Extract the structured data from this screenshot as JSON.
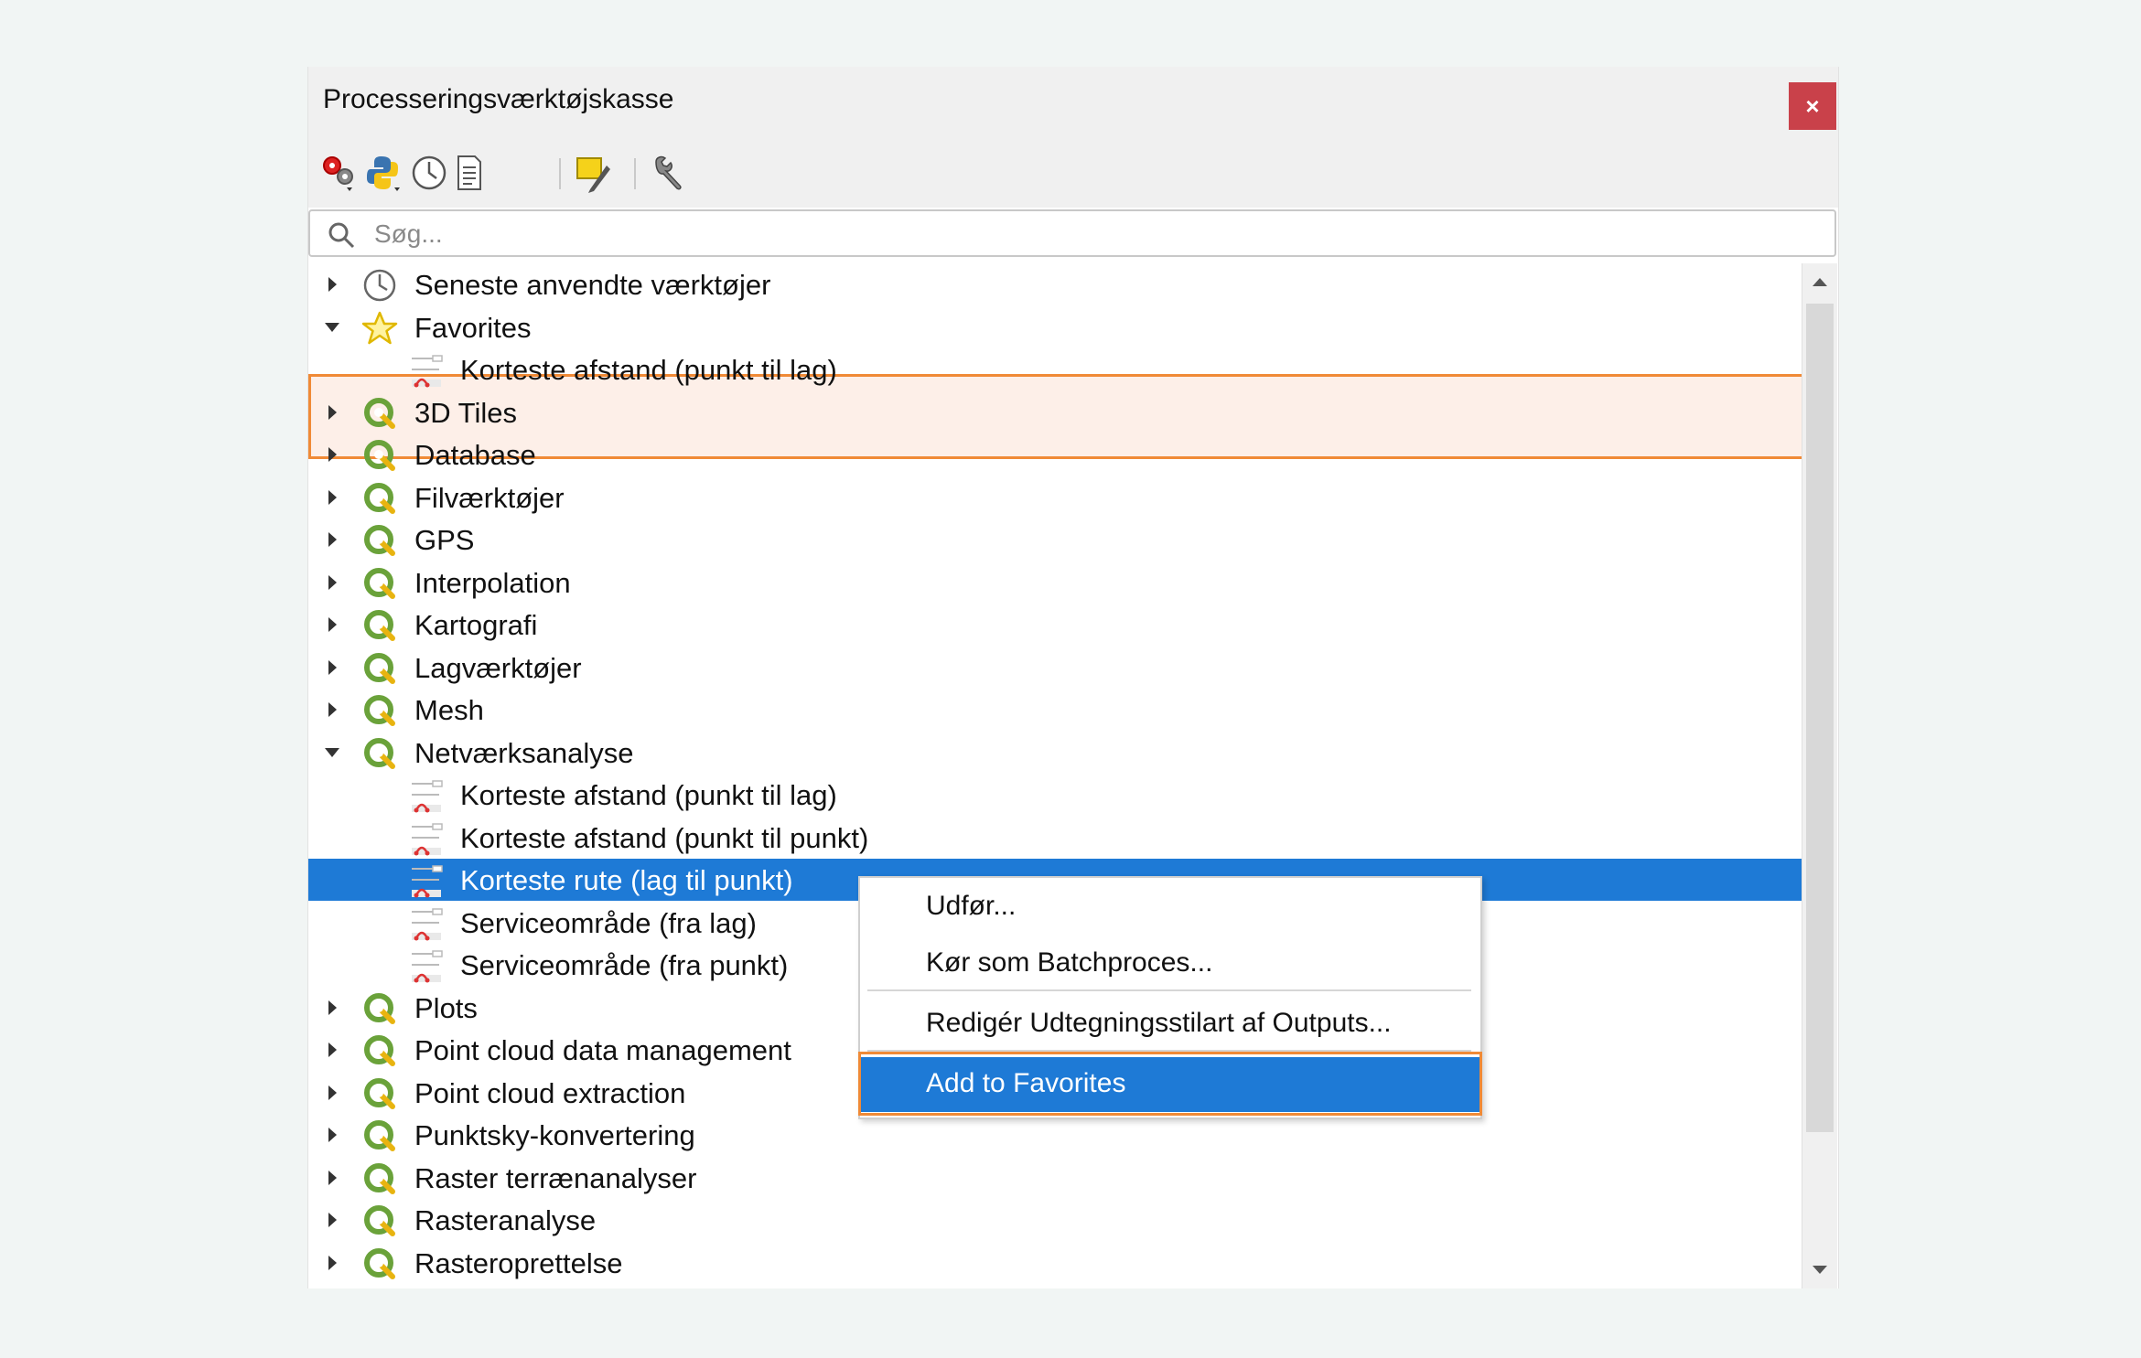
{
  "panel": {
    "title": "Processeringsværktøjskasse",
    "close_label": "×"
  },
  "toolbar": {
    "buttons": [
      "models-gear-icon",
      "python-icon",
      "history-clock-icon",
      "results-document-icon",
      "edit-features-icon",
      "options-wrench-icon"
    ]
  },
  "search": {
    "placeholder": "Søg..."
  },
  "tree": [
    {
      "label": "Seneste anvendte værktøjer",
      "icon": "clock-icon",
      "expanded": false
    },
    {
      "label": "Favorites",
      "icon": "star-icon",
      "expanded": true
    },
    {
      "label": "Korteste afstand (punkt til lag)",
      "icon": "algorithm-icon",
      "child": true
    },
    {
      "label": "3D Tiles",
      "icon": "qgis-icon",
      "expanded": false
    },
    {
      "label": "Database",
      "icon": "qgis-icon",
      "expanded": false
    },
    {
      "label": "Filværktøjer",
      "icon": "qgis-icon",
      "expanded": false
    },
    {
      "label": "GPS",
      "icon": "qgis-icon",
      "expanded": false
    },
    {
      "label": "Interpolation",
      "icon": "qgis-icon",
      "expanded": false
    },
    {
      "label": "Kartografi",
      "icon": "qgis-icon",
      "expanded": false
    },
    {
      "label": "Lagværktøjer",
      "icon": "qgis-icon",
      "expanded": false
    },
    {
      "label": "Mesh",
      "icon": "qgis-icon",
      "expanded": false
    },
    {
      "label": "Netværksanalyse",
      "icon": "qgis-icon",
      "expanded": true
    },
    {
      "label": "Korteste afstand (punkt til lag)",
      "icon": "algorithm-icon",
      "child": true
    },
    {
      "label": "Korteste afstand (punkt til punkt)",
      "icon": "algorithm-icon",
      "child": true
    },
    {
      "label": "Korteste rute (lag til punkt)",
      "icon": "algorithm-icon",
      "child": true,
      "selected": true
    },
    {
      "label": "Serviceområde (fra lag)",
      "icon": "algorithm-icon",
      "child": true
    },
    {
      "label": "Serviceområde (fra punkt)",
      "icon": "algorithm-icon",
      "child": true
    },
    {
      "label": "Plots",
      "icon": "qgis-icon",
      "expanded": false
    },
    {
      "label": "Point cloud data management",
      "icon": "qgis-icon",
      "expanded": false
    },
    {
      "label": "Point cloud extraction",
      "icon": "qgis-icon",
      "expanded": false
    },
    {
      "label": "Punktsky-konvertering",
      "icon": "qgis-icon",
      "expanded": false
    },
    {
      "label": "Raster terrænanalyser",
      "icon": "qgis-icon",
      "expanded": false
    },
    {
      "label": "Rasteranalyse",
      "icon": "qgis-icon",
      "expanded": false
    },
    {
      "label": "Rasteroprettelse",
      "icon": "qgis-icon",
      "expanded": false
    }
  ],
  "context_menu": {
    "items": [
      "Udfør...",
      "Kør som Batchproces...",
      "Redigér Udtegningsstilart af Outputs...",
      "Add to Favorites"
    ]
  },
  "colors": {
    "selection": "#1e7ad6",
    "highlight_border": "#f08a36",
    "highlight_fill": "#fdefe8",
    "close_button": "#c9414a"
  }
}
